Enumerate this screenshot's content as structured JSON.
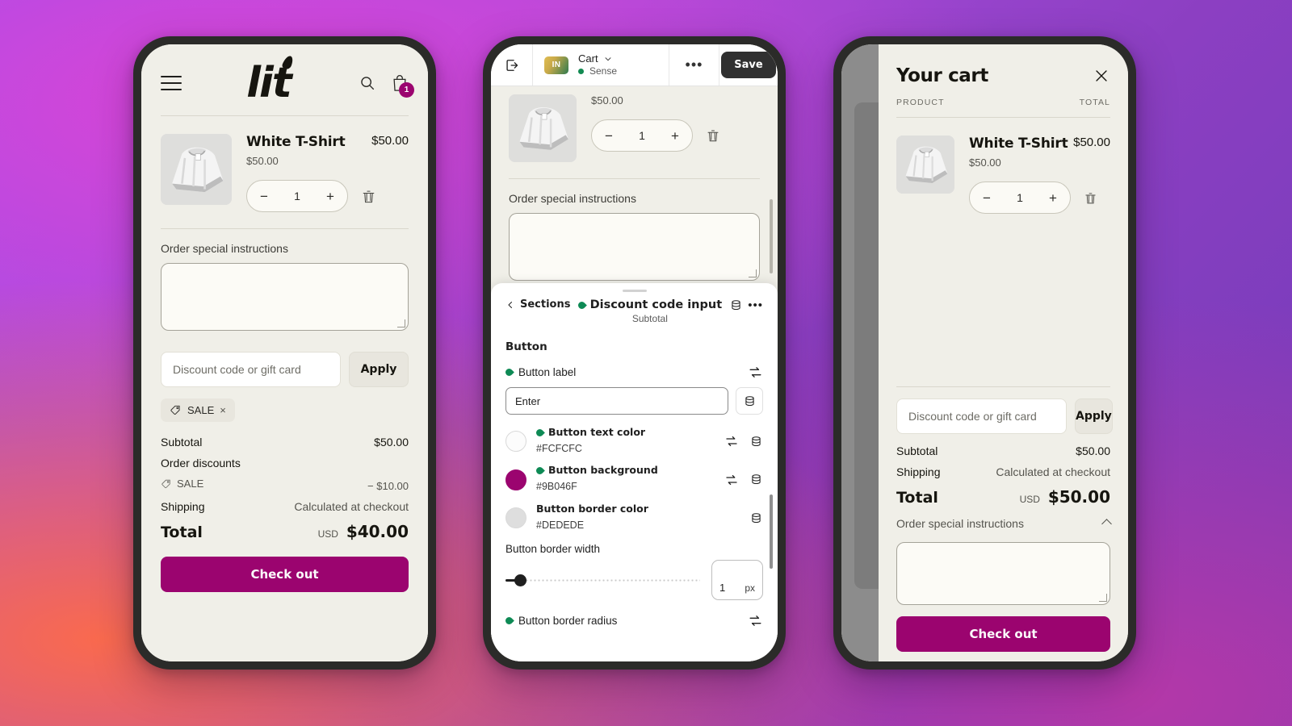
{
  "storefront": {
    "brand": "lit",
    "cart_badge_count": "1",
    "product": {
      "title": "White T-Shirt",
      "line_total": "$50.00",
      "unit_price": "$50.00",
      "quantity": "1",
      "minus": "−",
      "plus": "+"
    },
    "special_instructions_label": "Order special instructions",
    "discount_placeholder": "Discount code or gift card",
    "apply_label": "Apply",
    "discount_pill": {
      "label": "SALE",
      "remove": "×"
    },
    "totals": {
      "subtotal_label": "Subtotal",
      "subtotal_value": "$50.00",
      "order_discounts_label": "Order discounts",
      "discount_name": "SALE",
      "discount_value": "− $10.00",
      "shipping_label": "Shipping",
      "shipping_value": "Calculated at checkout",
      "total_label": "Total",
      "total_currency": "USD",
      "total_value": "$40.00"
    },
    "checkout_label": "Check out"
  },
  "editor": {
    "topbar": {
      "store_initials": "IN",
      "page_name": "Cart",
      "theme_name": "Sense",
      "more": "•••",
      "save_label": "Save"
    },
    "preview": {
      "unit_price": "$50.00",
      "quantity": "1",
      "minus": "−",
      "plus": "+",
      "special_instructions_label": "Order special instructions"
    },
    "inspector": {
      "back_label": "Sections",
      "title": "Discount code input",
      "subtitle": "Subtotal",
      "group_title": "Button",
      "button_label_field": {
        "label": "Button label",
        "value": "Enter"
      },
      "colors": [
        {
          "name": "Button text color",
          "hex": "#FCFCFC",
          "swatch": "#fcfcfc",
          "dynamic": true
        },
        {
          "name": "Button background",
          "hex": "#9B046F",
          "swatch": "#9b046f",
          "dynamic": true
        },
        {
          "name": "Button border color",
          "hex": "#DEDEDE",
          "swatch": "#dedede",
          "dynamic": false
        }
      ],
      "border_width": {
        "label": "Button border width",
        "value": "1",
        "unit": "px"
      },
      "border_radius_label": "Button border radius"
    }
  },
  "drawer": {
    "title": "Your cart",
    "col_product": "PRODUCT",
    "col_total": "TOTAL",
    "product": {
      "title": "White T-Shirt",
      "line_total": "$50.00",
      "unit_price": "$50.00",
      "quantity": "1",
      "minus": "−",
      "plus": "+"
    },
    "discount_placeholder": "Discount code or gift card",
    "apply_label": "Apply",
    "totals": {
      "subtotal_label": "Subtotal",
      "subtotal_value": "$50.00",
      "shipping_label": "Shipping",
      "shipping_value": "Calculated at checkout",
      "total_label": "Total",
      "total_currency": "USD",
      "total_value": "$50.00"
    },
    "special_instructions_label": "Order special instructions",
    "checkout_label": "Check out"
  },
  "colors": {
    "accent": "#9B046F",
    "storefront_bg": "#F0EFE8",
    "phone_frame": "#2B2B29",
    "editor_leaf_green": "#0E8A55"
  }
}
